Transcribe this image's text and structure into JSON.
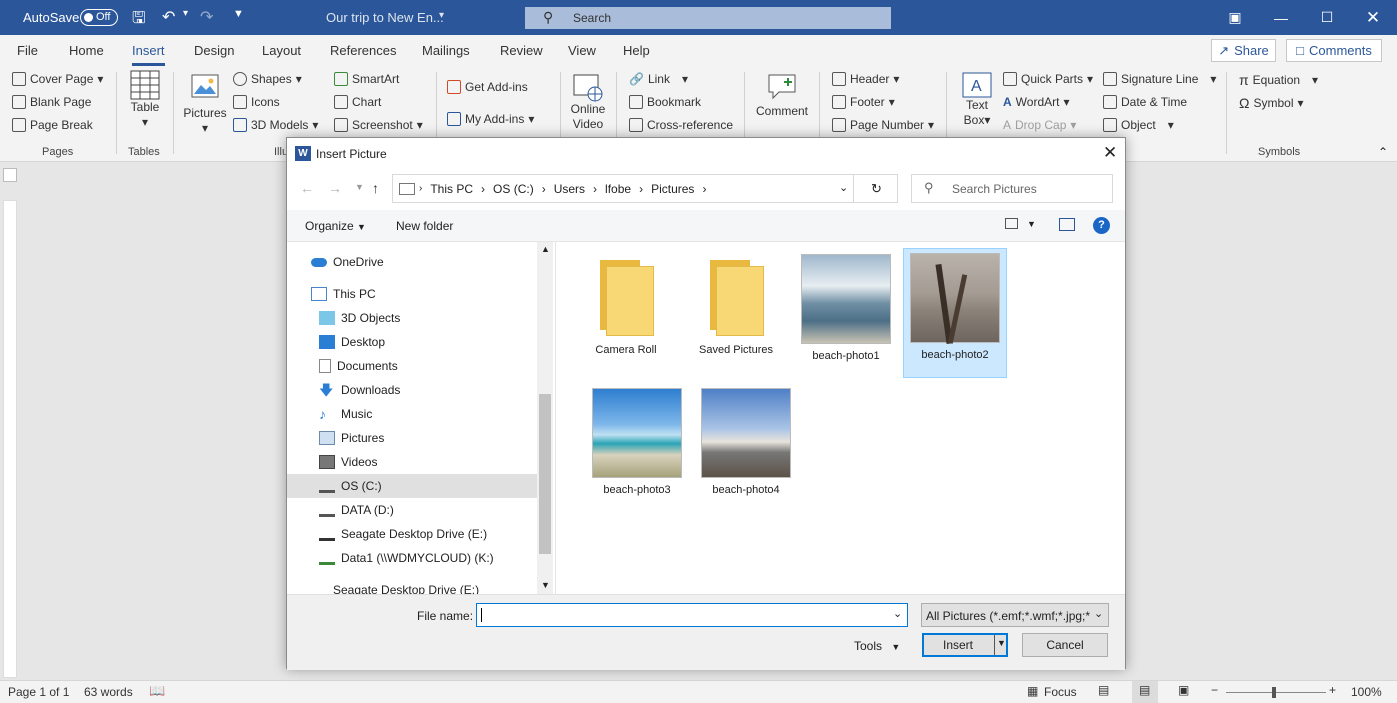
{
  "titlebar": {
    "autosave_label": "AutoSave",
    "autosave_state": "Off",
    "doc_title": "Our trip to New En...",
    "search_placeholder": "Search"
  },
  "tabs": [
    "File",
    "Home",
    "Insert",
    "Design",
    "Layout",
    "References",
    "Mailings",
    "Review",
    "View",
    "Help"
  ],
  "share_label": "Share",
  "comments_label": "Comments",
  "ribbon": {
    "pages": {
      "cover": "Cover Page",
      "blank": "Blank Page",
      "break": "Page Break",
      "group": "Pages"
    },
    "tables": {
      "table": "Table",
      "group": "Tables"
    },
    "illus": {
      "pictures": "Pictures",
      "shapes": "Shapes",
      "icons": "Icons",
      "models": "3D Models",
      "smartart": "SmartArt",
      "chart": "Chart",
      "screenshot": "Screenshot",
      "group": "Illu"
    },
    "addins": {
      "get": "Get Add-ins",
      "my": "My Add-ins"
    },
    "media": {
      "online1": "Online",
      "online2": "Video"
    },
    "links": {
      "link": "Link",
      "bookmark": "Bookmark",
      "xref": "Cross-reference"
    },
    "comments": {
      "comment": "Comment"
    },
    "hf": {
      "header": "Header",
      "footer": "Footer",
      "pagenum": "Page Number"
    },
    "text": {
      "tb1": "Text",
      "tb2": "Box",
      "quick": "Quick Parts",
      "wordart": "WordArt",
      "dropcap": "Drop Cap",
      "sig": "Signature Line",
      "date": "Date & Time",
      "object": "Object"
    },
    "symbols": {
      "equation": "Equation",
      "symbol": "Symbol",
      "group": "Symbols"
    }
  },
  "dialog": {
    "title": "Insert Picture",
    "breadcrumb": [
      "This PC",
      "OS (C:)",
      "Users",
      "lfobe",
      "Pictures"
    ],
    "search_placeholder": "Search Pictures",
    "organize": "Organize",
    "new_folder": "New folder",
    "nav": [
      {
        "label": "OneDrive"
      },
      {
        "label": "This PC"
      },
      {
        "label": "3D Objects"
      },
      {
        "label": "Desktop"
      },
      {
        "label": "Documents"
      },
      {
        "label": "Downloads"
      },
      {
        "label": "Music"
      },
      {
        "label": "Pictures"
      },
      {
        "label": "Videos"
      },
      {
        "label": "OS (C:)"
      },
      {
        "label": "DATA (D:)"
      },
      {
        "label": "Seagate Desktop Drive (E:)"
      },
      {
        "label": "Data1 (\\\\WDMYCLOUD) (K:)"
      },
      {
        "label": "Seagate Desktop Drive (E:)"
      }
    ],
    "files": [
      {
        "label": "Camera Roll",
        "kind": "folder"
      },
      {
        "label": "Saved Pictures",
        "kind": "folder"
      },
      {
        "label": "beach-photo1",
        "kind": "image"
      },
      {
        "label": "beach-photo2",
        "kind": "image",
        "selected": true
      },
      {
        "label": "beach-photo3",
        "kind": "image"
      },
      {
        "label": "beach-photo4",
        "kind": "image"
      }
    ],
    "filename_label": "File name:",
    "filename_value": "",
    "filter": "All Pictures (*.emf;*.wmf;*.jpg;*",
    "tools": "Tools",
    "insert": "Insert",
    "cancel": "Cancel"
  },
  "status": {
    "page": "Page 1 of 1",
    "words": "63 words",
    "focus": "Focus",
    "zoom": "100%"
  },
  "colors": {
    "word_blue": "#2b579a",
    "select_blue": "#cce8ff",
    "folder_yellow": "#f8d775"
  }
}
